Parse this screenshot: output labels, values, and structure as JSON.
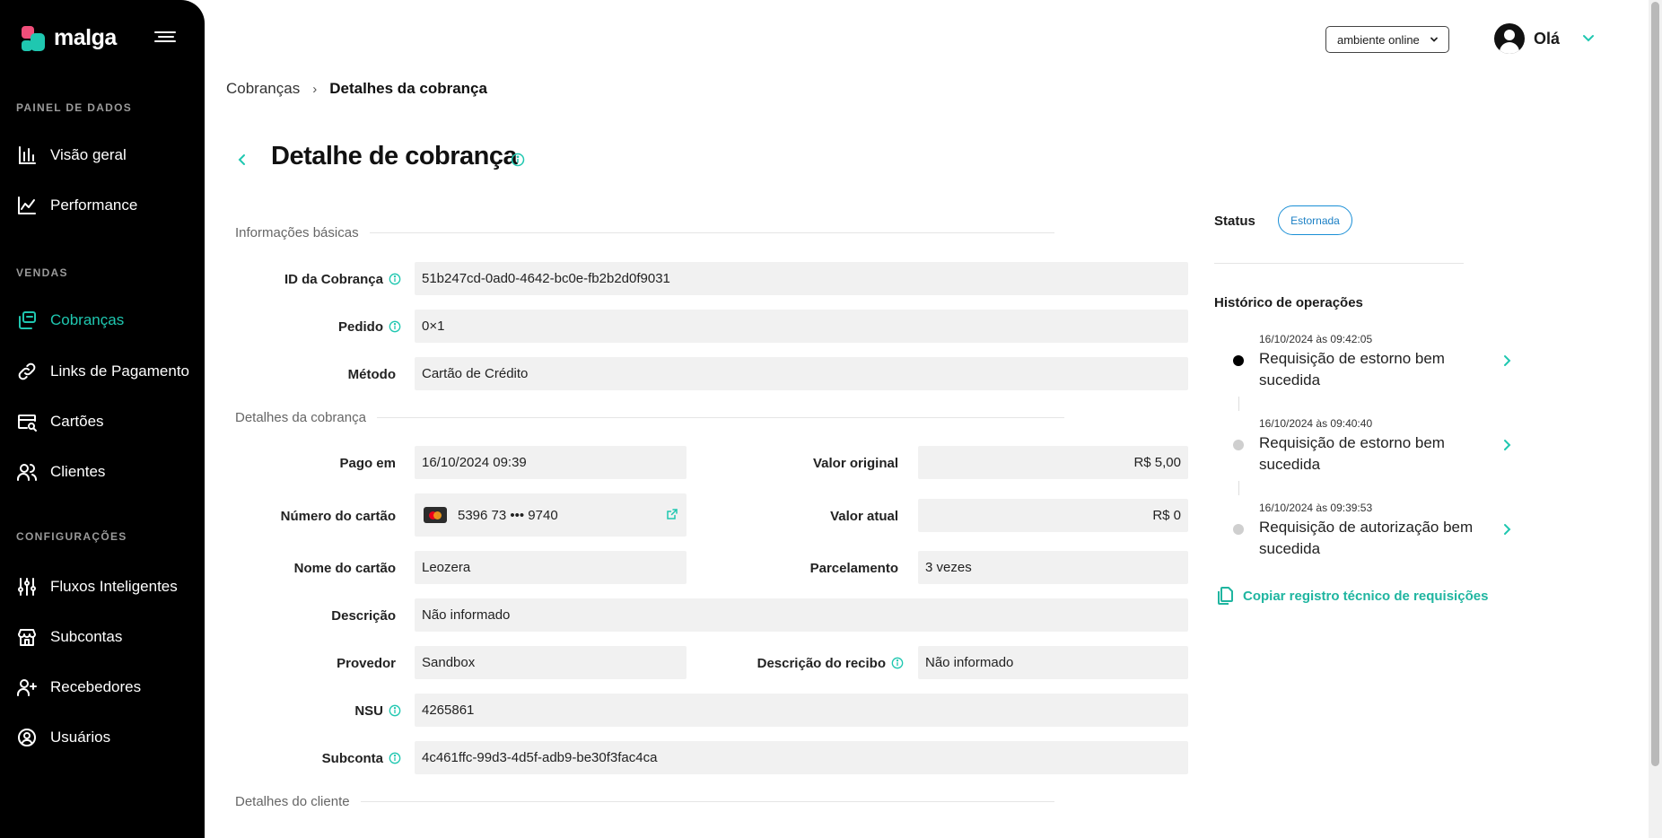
{
  "brand": {
    "name": "malga",
    "colors": {
      "accent": "#1fc7b0",
      "pink": "#f04e7a",
      "status_blue": "#1a7fc4"
    }
  },
  "sidebar": {
    "sections": [
      {
        "label": "PAINEL DE DADOS",
        "items": [
          {
            "label": "Visão geral",
            "icon": "bar-chart-icon"
          },
          {
            "label": "Performance",
            "icon": "line-chart-icon"
          }
        ]
      },
      {
        "label": "VENDAS",
        "items": [
          {
            "label": "Cobranças",
            "icon": "charges-icon",
            "active": true
          },
          {
            "label": "Links de Pagamento",
            "icon": "link-icon"
          },
          {
            "label": "Cartões",
            "icon": "card-search-icon"
          },
          {
            "label": "Clientes",
            "icon": "users-icon"
          }
        ]
      },
      {
        "label": "CONFIGURAÇÕES",
        "items": [
          {
            "label": "Fluxos Inteligentes",
            "icon": "sliders-icon"
          },
          {
            "label": "Subcontas",
            "icon": "store-icon"
          },
          {
            "label": "Recebedores",
            "icon": "user-plus-icon"
          },
          {
            "label": "Usuários",
            "icon": "user-circle-icon"
          }
        ]
      }
    ]
  },
  "header": {
    "environment": "ambiente online",
    "greeting": "Olá"
  },
  "breadcrumb": {
    "parent": "Cobranças",
    "current": "Detalhes da cobrança"
  },
  "page": {
    "title": "Detalhe de cobrança"
  },
  "basic_info": {
    "title": "Informações básicas",
    "id_label": "ID da Cobrança",
    "id_value": "51b247cd-0ad0-4642-bc0e-fb2b2d0f9031",
    "order_label": "Pedido",
    "order_value": "0×1",
    "method_label": "Método",
    "method_value": "Cartão de Crédito"
  },
  "charge_details": {
    "title": "Detalhes da cobrança",
    "paid_label": "Pago em",
    "paid_value": "16/10/2024 09:39",
    "original_label": "Valor original",
    "original_value": "R$ 5,00",
    "card_number_label": "Número do cartão",
    "card_number_value": "5396 73 ••• 9740",
    "current_label": "Valor atual",
    "current_value": "R$ 0",
    "card_name_label": "Nome do cartão",
    "card_name_value": "Leozera",
    "installments_label": "Parcelamento",
    "installments_value": "3 vezes",
    "description_label": "Descrição",
    "description_value": "Não informado",
    "provider_label": "Provedor",
    "provider_value": "Sandbox",
    "receipt_label": "Descrição do recibo",
    "receipt_value": "Não informado",
    "nsu_label": "NSU",
    "nsu_value": "4265861",
    "subaccount_label": "Subconta",
    "subaccount_value": "4c461ffc-99d3-4d5f-adb9-be30f3fac4ca"
  },
  "customer_details": {
    "title": "Detalhes do cliente"
  },
  "status": {
    "label": "Status",
    "value": "Estornada"
  },
  "history": {
    "title": "Histórico de operações",
    "items": [
      {
        "time": "16/10/2024 às 09:42:05",
        "text": "Requisição de estorno bem sucedida",
        "current": true
      },
      {
        "time": "16/10/2024 às 09:40:40",
        "text": "Requisição de estorno bem sucedida",
        "current": false
      },
      {
        "time": "16/10/2024 às 09:39:53",
        "text": "Requisição de autorização bem sucedida",
        "current": false
      }
    ],
    "copy_label": "Copiar registro técnico de requisições"
  }
}
